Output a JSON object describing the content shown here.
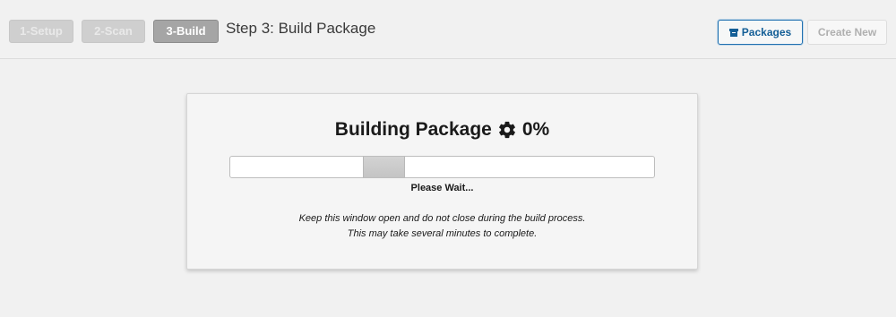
{
  "header": {
    "steps": [
      {
        "label": "1-Setup",
        "state": "inactive"
      },
      {
        "label": "2-Scan",
        "state": "inactive"
      },
      {
        "label": "3-Build",
        "state": "active"
      }
    ],
    "title": "Step 3: Build Package",
    "packages_button": {
      "label": "Packages",
      "icon": "archive-box-icon"
    },
    "create_new_button": {
      "label": "Create New",
      "state": "disabled"
    }
  },
  "build": {
    "title": "Building Package",
    "icon": "gear-icon",
    "percent": "0%",
    "progress_state": "indeterminate",
    "wait_text": "Please Wait...",
    "notice_line1": "Keep this window open and do not close during the build process.",
    "notice_line2": "This may take several minutes to complete."
  },
  "colors": {
    "accent": "#2271b1",
    "accent_text": "#135e96",
    "background": "#f1f1f1",
    "panel": "#f5f5f5"
  }
}
